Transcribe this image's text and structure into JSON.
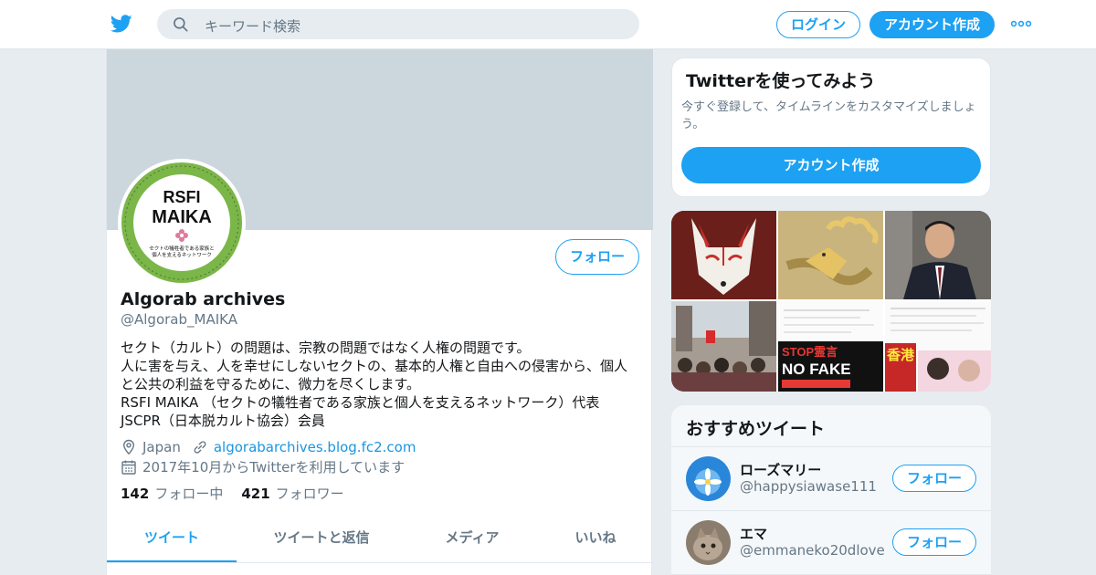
{
  "header": {
    "search_placeholder": "キーワード検索",
    "login_label": "ログイン",
    "signup_label": "アカウント作成"
  },
  "profile": {
    "avatar_text": {
      "line1": "RSFI",
      "line2": "MAIKA",
      "sub1": "セクトの犠牲者である家族と",
      "sub2": "個人を支えるネットワーク"
    },
    "follow_label": "フォロー",
    "name": "Algorab archives",
    "handle": "@Algorab_MAIKA",
    "bio": [
      "セクト（カルト）の問題は、宗教の問題ではなく人権の問題です。",
      "人に害を与え、人を幸せにしないセクトの、基本的人権と自由への侵害から、個人",
      "と公共の利益を守るために、微力を尽くします。",
      "RSFI MAIKA （セクトの犠牲者である家族と個人を支えるネットワーク）代表",
      "JSCPR（日本脱カルト協会）会員"
    ],
    "location": "Japan",
    "url": "algorabarchives.blog.fc2.com",
    "joined": "2017年10月からTwitterを利用しています",
    "following_count": "142",
    "following_label": "フォロー中",
    "followers_count": "421",
    "followers_label": "フォロワー",
    "tabs": [
      "ツイート",
      "ツイートと返信",
      "メディア",
      "いいね"
    ]
  },
  "signup_card": {
    "title": "Twitterを使ってみよう",
    "description": "今すぐ登録して、タイムラインをカスタマイズしましょう。",
    "button": "アカウント作成"
  },
  "media_tiles": {
    "stop_text": "STOP霊言",
    "no_fake_text": "NO FAKE",
    "hongkong_text": "香港"
  },
  "recommended": {
    "title": "おすすめツイート",
    "users": [
      {
        "name": "ローズマリー",
        "handle": "@happysiawase111",
        "follow": "フォロー"
      },
      {
        "name": "エマ",
        "handle": "@emmaneko20dlove",
        "follow": "フォロー"
      }
    ]
  },
  "colors": {
    "accent": "#1da1f2",
    "banner": "#ccd6dd",
    "background": "#e6ecf0",
    "avatar_ring": "#7ab648"
  }
}
